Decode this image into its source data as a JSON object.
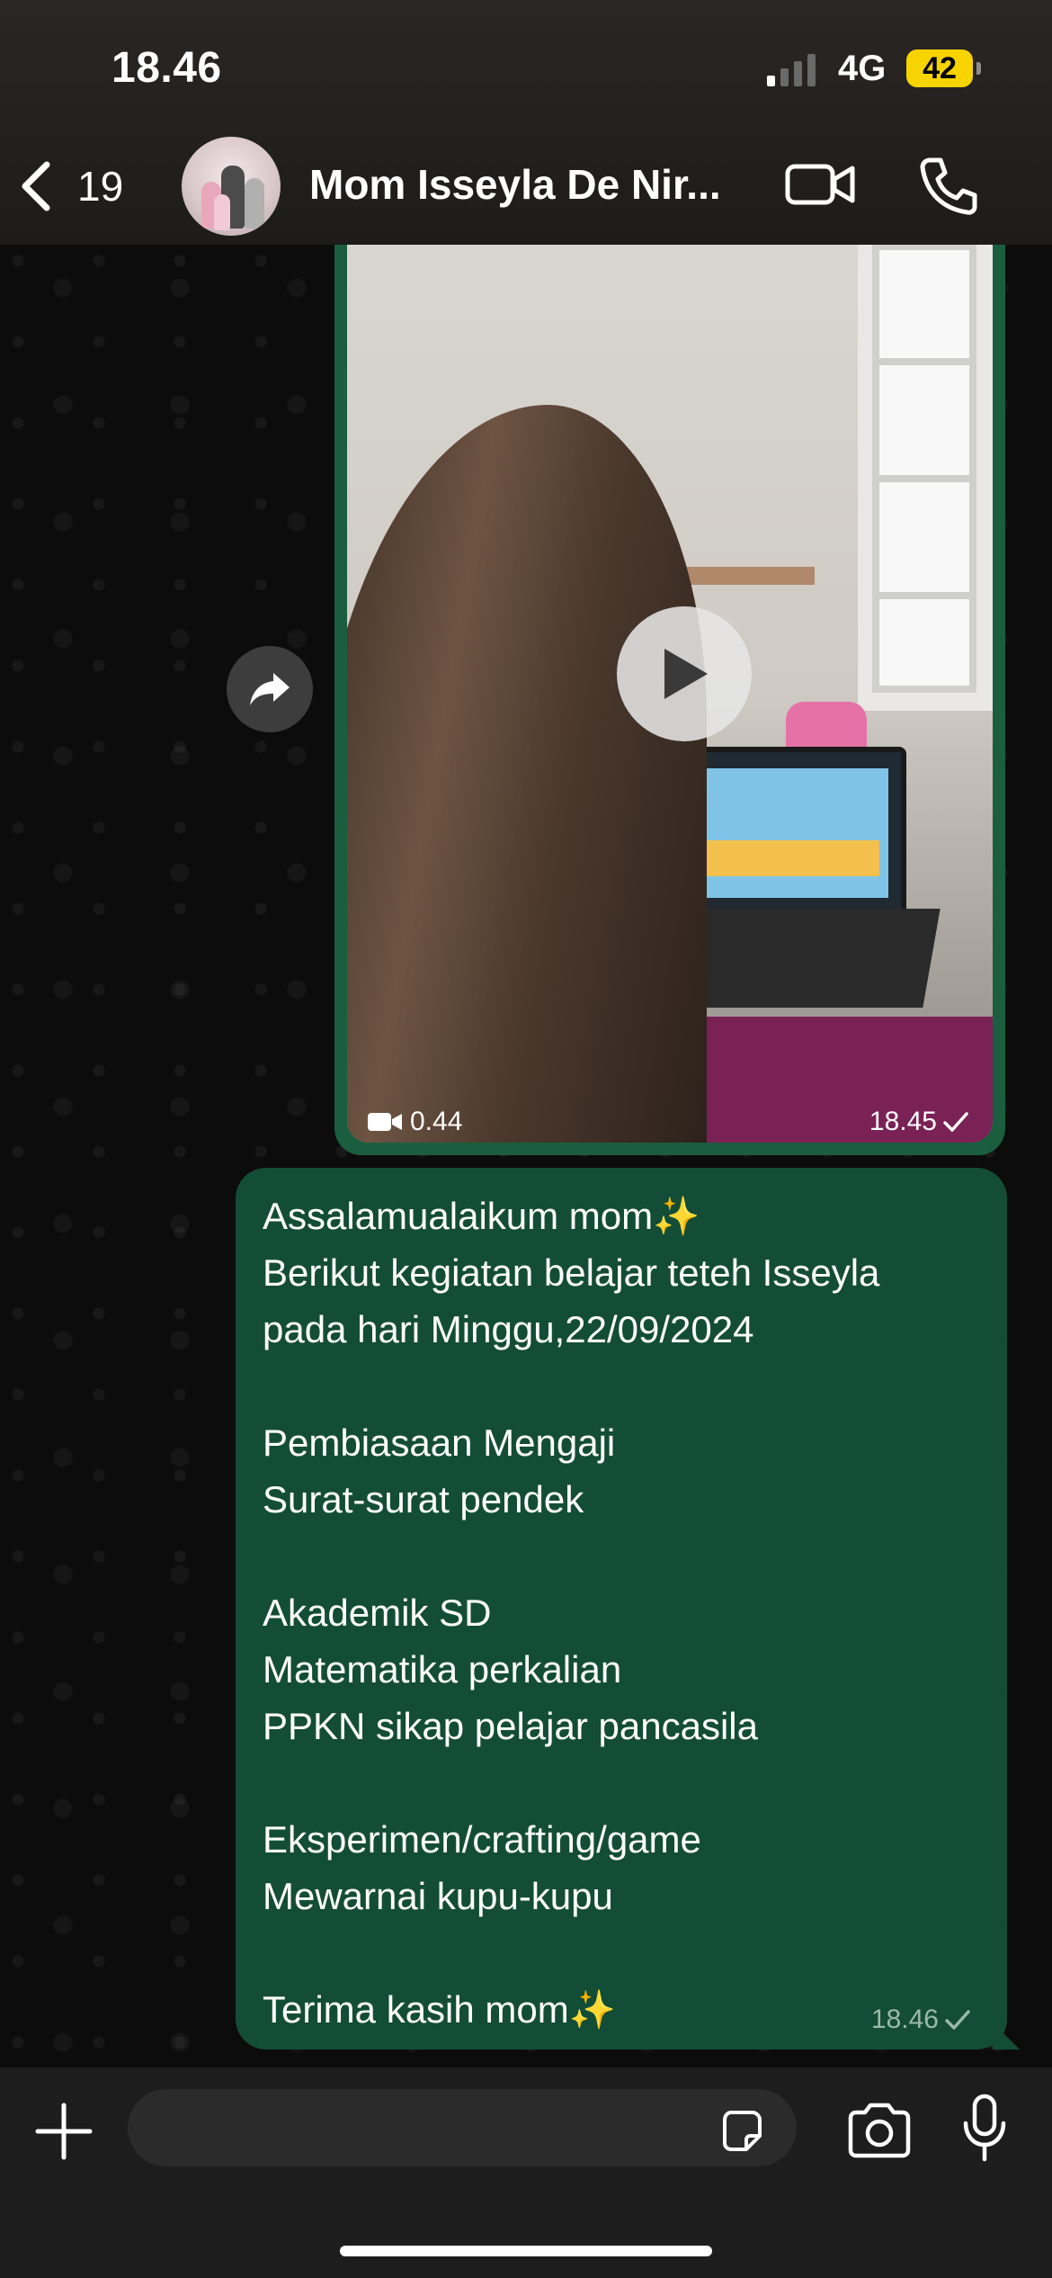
{
  "status_bar": {
    "time": "18.46",
    "network": "4G",
    "battery": "42"
  },
  "header": {
    "back_count": "19",
    "chat_title": "Mom Isseyla De Nir..."
  },
  "video_message": {
    "duration": "0.44",
    "time": "18.45"
  },
  "text_message": {
    "lines": [
      "Assalamualaikum mom✨",
      "Berikut kegiatan belajar teteh Isseyla",
      "pada hari Minggu,22/09/2024",
      "",
      "Pembiasaan Mengaji",
      "Surat-surat pendek",
      "",
      "Akademik SD",
      "Matematika perkalian",
      "PPKN sikap pelajar pancasila",
      "",
      "Eksperimen/crafting/game",
      "Mewarnai kupu-kupu",
      "",
      "Terima kasih mom✨"
    ],
    "time": "18.46"
  },
  "input_bar": {
    "placeholder": ""
  },
  "colors": {
    "outgoing_bubble": "#144d37",
    "header_bg": "#1d1c1b",
    "battery_accent": "#f7d400"
  }
}
